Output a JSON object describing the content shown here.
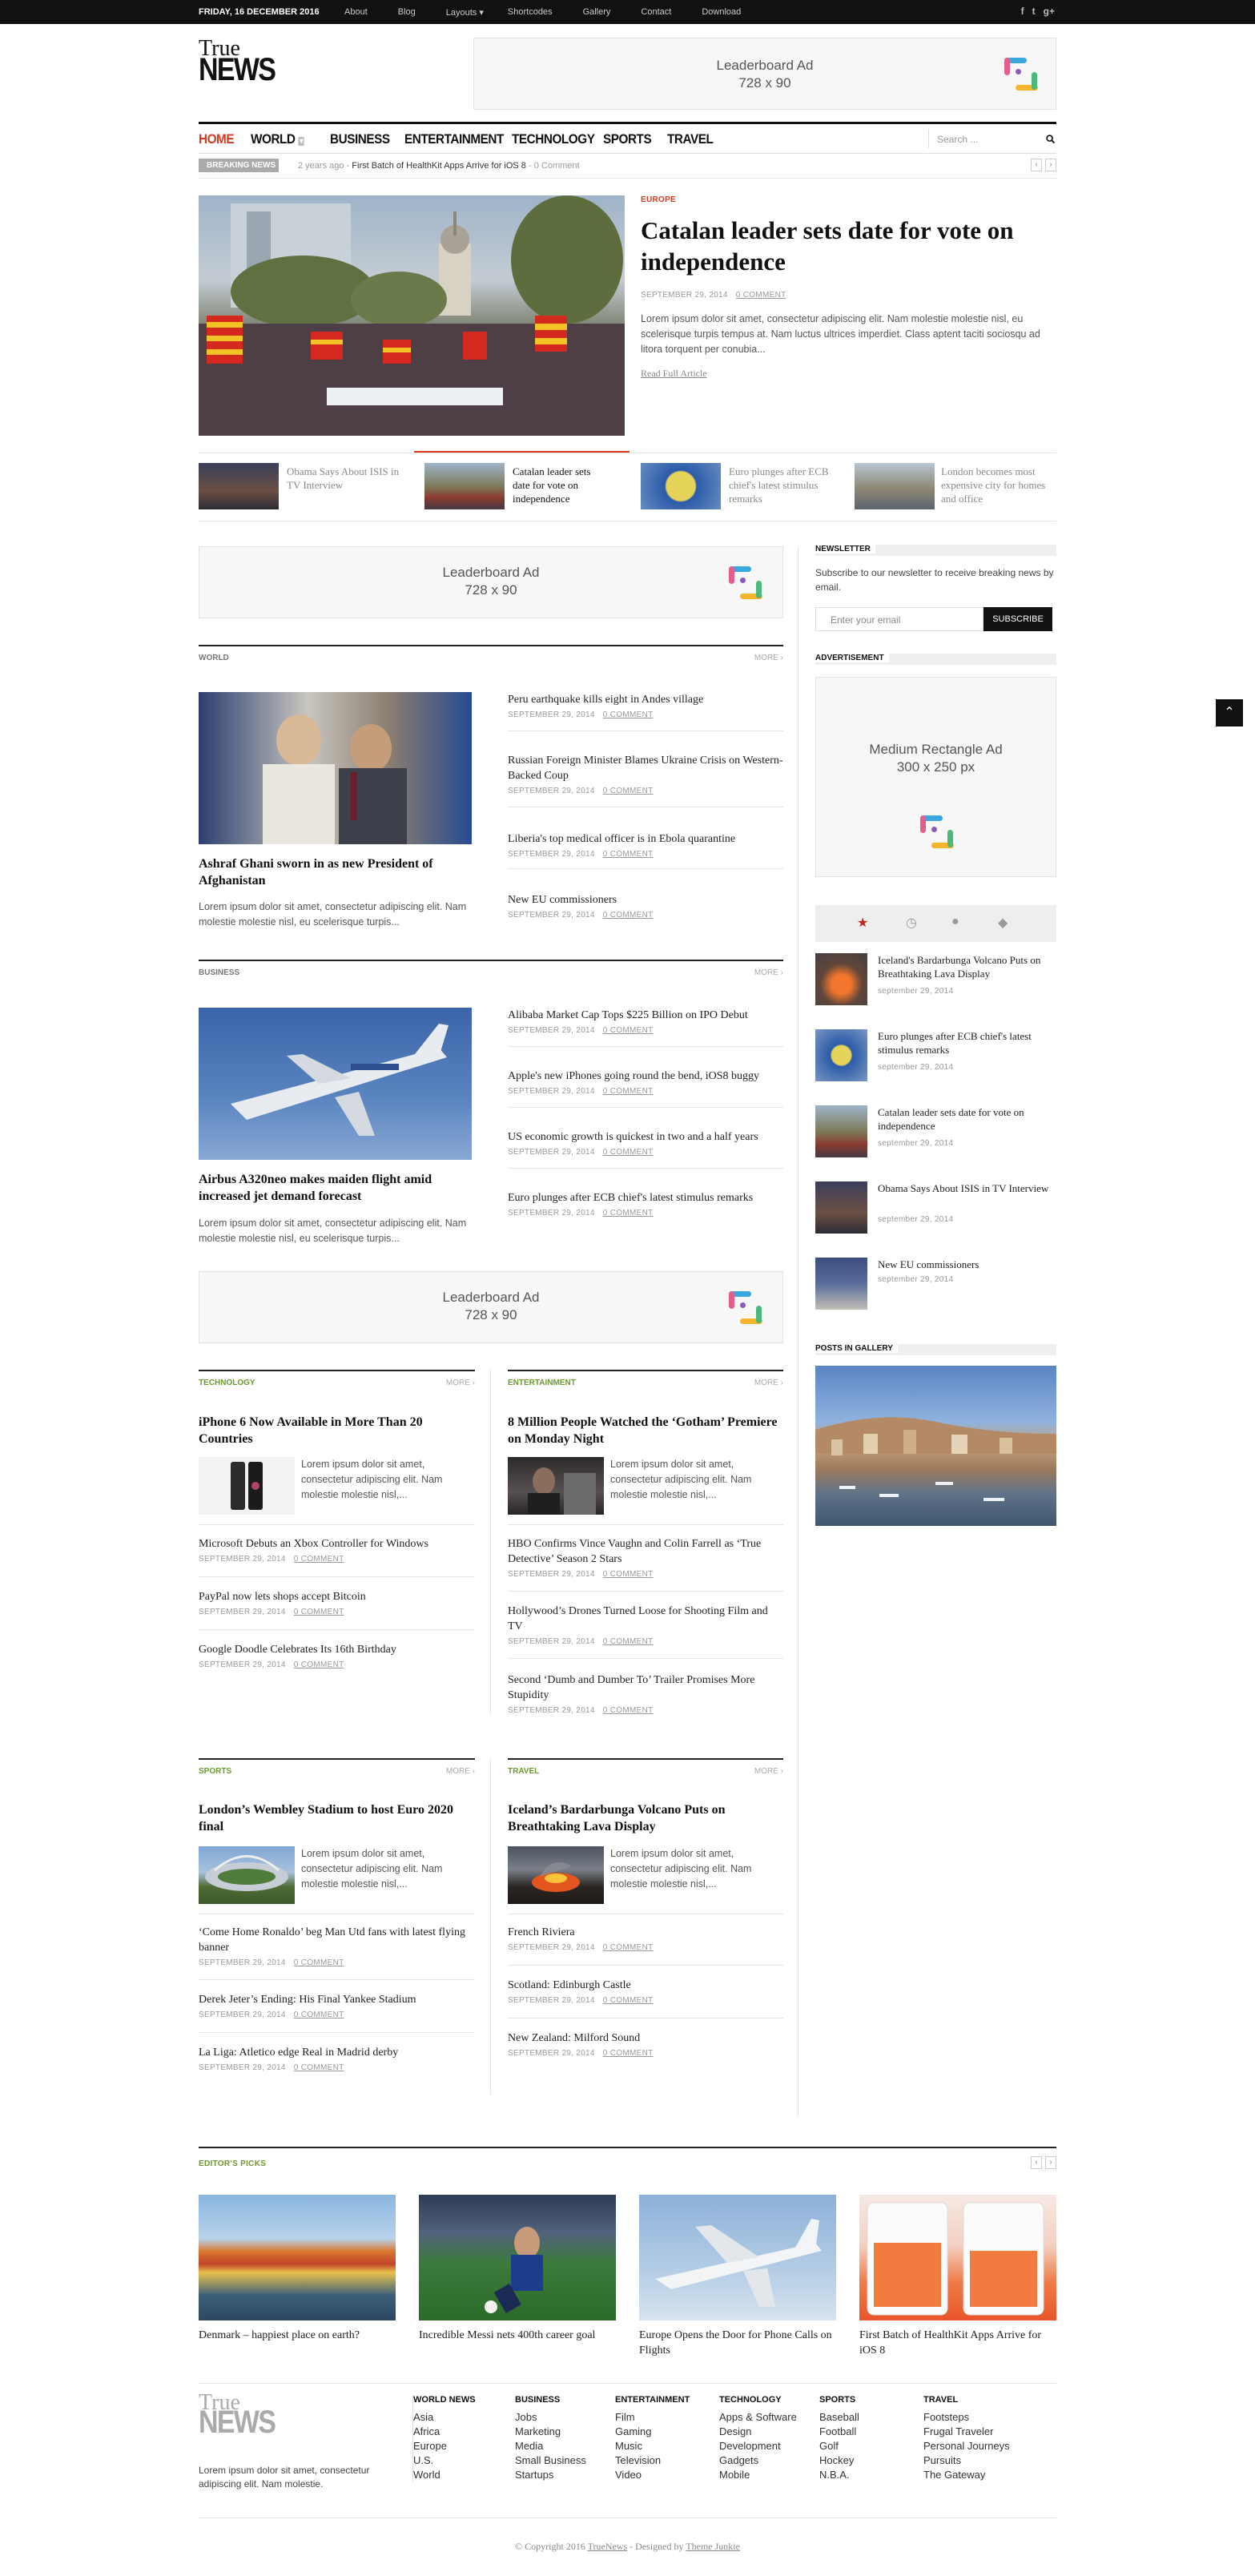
{
  "topbar": {
    "date": "FRIDAY, 16 DECEMBER 2016",
    "nav": [
      "About",
      "Blog",
      "Layouts",
      "Shortcodes",
      "Gallery",
      "Contact",
      "Download"
    ],
    "layouts_arrow": "▾",
    "social": [
      "f",
      "t",
      "g+"
    ]
  },
  "logo": {
    "line1": "True",
    "line2": "NEWS"
  },
  "ads": {
    "leaderboard_title": "Leaderboard Ad",
    "leaderboard_size": "728 x 90",
    "rect_title": "Medium Rectangle Ad",
    "rect_size": "300 x 250 px"
  },
  "nav": {
    "items": [
      "HOME",
      "WORLD",
      "BUSINESS",
      "ENTERTAINMENT",
      "TECHNOLOGY",
      "SPORTS",
      "TRAVEL"
    ],
    "world_arrow": "▾",
    "search_placeholder": "Search ..."
  },
  "breaking": {
    "label": "BREAKING NEWS",
    "time": "2 years ago",
    "sep": "-",
    "headline": "First Batch of HealthKit Apps Arrive for iOS 8",
    "comments": "- 0 Comment",
    "prev": "‹",
    "next": "›"
  },
  "hero": {
    "category": "EUROPE",
    "title": "Catalan leader sets date for vote on independence",
    "date": "SEPTEMBER 29, 2014",
    "comments": "0 COMMENT",
    "excerpt": "Lorem ipsum dolor sit amet, consectetur adipiscing elit. Nam molestie molestie nisl, eu scelerisque turpis tempus at. Nam luctus ultrices imperdiet. Class aptent taciti sociosqu ad litora torquent per conubia...",
    "read_more": "Read Full Article"
  },
  "strip": [
    {
      "title": "Obama Says About ISIS in TV Interview"
    },
    {
      "title": "Catalan leader sets date for vote on independence"
    },
    {
      "title": "Euro plunges after ECB chief's latest stimulus remarks"
    },
    {
      "title": "London becomes most expensive city for homes and office"
    }
  ],
  "world": {
    "label": "WORLD",
    "more": "MORE ›",
    "main_title": "Ashraf Ghani sworn in as new President of Afghanistan",
    "main_excerpt": "Lorem ipsum dolor sit amet, consectetur adipiscing elit. Nam molestie molestie nisl, eu scelerisque turpis...",
    "list": [
      {
        "title": "Peru earthquake kills eight in Andes village",
        "date": "SEPTEMBER 29, 2014",
        "comments": "0 COMMENT"
      },
      {
        "title": "Russian Foreign Minister Blames Ukraine Crisis on Western-Backed Coup",
        "date": "SEPTEMBER 29, 2014",
        "comments": "0 COMMENT"
      },
      {
        "title": "Liberia's top medical officer is in Ebola quarantine",
        "date": "SEPTEMBER 29, 2014",
        "comments": "0 COMMENT"
      },
      {
        "title": "New EU commissioners",
        "date": "SEPTEMBER 29, 2014",
        "comments": "0 COMMENT"
      }
    ]
  },
  "business": {
    "label": "BUSINESS",
    "more": "MORE ›",
    "main_title": "Airbus A320neo makes maiden flight amid increased jet demand forecast",
    "main_excerpt": "Lorem ipsum dolor sit amet, consectetur adipiscing elit. Nam molestie molestie nisl, eu scelerisque turpis...",
    "list": [
      {
        "title": "Alibaba Market Cap Tops $225 Billion on IPO Debut",
        "date": "SEPTEMBER 29, 2014",
        "comments": "0 COMMENT"
      },
      {
        "title": "Apple's new iPhones going round the bend, iOS8 buggy",
        "date": "SEPTEMBER 29, 2014",
        "comments": "0 COMMENT"
      },
      {
        "title": "US economic growth is quickest in two and a half years",
        "date": "SEPTEMBER 29, 2014",
        "comments": "0 COMMENT"
      },
      {
        "title": "Euro plunges after ECB chief's latest stimulus remarks",
        "date": "SEPTEMBER 29, 2014",
        "comments": "0 COMMENT"
      }
    ]
  },
  "technology": {
    "label": "TECHNOLOGY",
    "more": "MORE ›",
    "main_title": "iPhone 6 Now Available in More Than 20 Countries",
    "excerpt": "Lorem ipsum dolor sit amet, consectetur adipiscing elit. Nam molestie molestie nisl,...",
    "list": [
      {
        "title": "Microsoft Debuts an Xbox Controller for Windows",
        "date": "SEPTEMBER 29, 2014",
        "comments": "0 COMMENT"
      },
      {
        "title": "PayPal now lets shops accept Bitcoin",
        "date": "SEPTEMBER 29, 2014",
        "comments": "0 COMMENT"
      },
      {
        "title": "Google Doodle Celebrates Its 16th Birthday",
        "date": "SEPTEMBER 29, 2014",
        "comments": "0 COMMENT"
      }
    ]
  },
  "entertainment": {
    "label": "ENTERTAINMENT",
    "more": "MORE ›",
    "main_title": "8 Million People Watched the ‘Gotham’ Premiere on Monday Night",
    "excerpt": "Lorem ipsum dolor sit amet, consectetur adipiscing elit. Nam molestie molestie nisl,...",
    "list": [
      {
        "title": "HBO Confirms Vince Vaughn and Colin Farrell as ‘True Detective’ Season 2 Stars",
        "date": "SEPTEMBER 29, 2014",
        "comments": "0 COMMENT"
      },
      {
        "title": "Hollywood’s Drones Turned Loose for Shooting Film and TV",
        "date": "SEPTEMBER 29, 2014",
        "comments": "0 COMMENT"
      },
      {
        "title": "Second ‘Dumb and Dumber To’ Trailer Promises More Stupidity",
        "date": "SEPTEMBER 29, 2014",
        "comments": "0 COMMENT"
      }
    ]
  },
  "sports": {
    "label": "SPORTS",
    "more": "MORE ›",
    "main_title": "London’s Wembley Stadium to host Euro 2020 final",
    "excerpt": "Lorem ipsum dolor sit amet, consectetur adipiscing elit. Nam molestie molestie nisl,...",
    "list": [
      {
        "title": "‘Come Home Ronaldo’ beg Man Utd fans with latest flying banner",
        "date": "SEPTEMBER 29, 2014",
        "comments": "0 COMMENT"
      },
      {
        "title": "Derek Jeter’s Ending: His Final Yankee Stadium",
        "date": "SEPTEMBER 29, 2014",
        "comments": "0 COMMENT"
      },
      {
        "title": "La Liga: Atletico edge Real in Madrid derby",
        "date": "SEPTEMBER 29, 2014",
        "comments": "0 COMMENT"
      }
    ]
  },
  "travel": {
    "label": "TRAVEL",
    "more": "MORE ›",
    "main_title": "Iceland’s Bardarbunga Volcano Puts on Breathtaking Lava Display",
    "excerpt": "Lorem ipsum dolor sit amet, consectetur adipiscing elit. Nam molestie molestie nisl,...",
    "list": [
      {
        "title": "French Riviera",
        "date": "SEPTEMBER 29, 2014",
        "comments": "0 COMMENT"
      },
      {
        "title": "Scotland: Edinburgh Castle",
        "date": "SEPTEMBER 29, 2014",
        "comments": "0 COMMENT"
      },
      {
        "title": "New Zealand: Milford Sound",
        "date": "SEPTEMBER 29, 2014",
        "comments": "0 COMMENT"
      }
    ]
  },
  "sidebar": {
    "newsletter_title": "NEWSLETTER",
    "newsletter_text": "Subscribe to our newsletter to receive breaking news by email.",
    "email_placeholder": "Enter your email",
    "subscribe": "SUBSCRIBE",
    "ad_title": "ADVERTISEMENT",
    "tabs": [
      "★",
      "◷",
      "●",
      "◆"
    ],
    "posts": [
      {
        "title": "Iceland's Bardarbunga Volcano Puts on Breathtaking Lava Display",
        "date": "september 29, 2014"
      },
      {
        "title": "Euro plunges after ECB chief's latest stimulus remarks",
        "date": "september 29, 2014"
      },
      {
        "title": "Catalan leader sets date for vote on independence",
        "date": "september 29, 2014"
      },
      {
        "title": "Obama Says About ISIS in TV Interview",
        "date": "september 29, 2014"
      },
      {
        "title": "New EU commissioners",
        "date": "september 29, 2014"
      }
    ],
    "gallery_title": "POSTS IN GALLERY",
    "scroll_top": "⌃"
  },
  "editors": {
    "label": "EDITOR'S PICKS",
    "prev": "‹",
    "next": "›",
    "items": [
      {
        "title": "Denmark – happiest place on earth?"
      },
      {
        "title": "Incredible Messi nets 400th career goal"
      },
      {
        "title": "Europe Opens the Door for Phone Calls on Flights"
      },
      {
        "title": "First Batch of HealthKit Apps Arrive for iOS 8"
      }
    ]
  },
  "footer": {
    "logo1": "True",
    "logo2": "NEWS",
    "about": "Lorem ipsum dolor sit amet, consectetur adipiscing elit. Nam molestie.",
    "cols": [
      {
        "title": "WORLD NEWS",
        "links": [
          "Asia",
          "Africa",
          "Europe",
          "U.S.",
          "World"
        ]
      },
      {
        "title": "BUSINESS",
        "links": [
          "Jobs",
          "Marketing",
          "Media",
          "Small Business",
          "Startups"
        ]
      },
      {
        "title": "ENTERTAINMENT",
        "links": [
          "Film",
          "Gaming",
          "Music",
          "Television",
          "Video"
        ]
      },
      {
        "title": "TECHNOLOGY",
        "links": [
          "Apps & Software",
          "Design",
          "Development",
          "Gadgets",
          "Mobile"
        ]
      },
      {
        "title": "SPORTS",
        "links": [
          "Baseball",
          "Football",
          "Golf",
          "Hockey",
          "N.B.A."
        ]
      },
      {
        "title": "TRAVEL",
        "links": [
          "Footsteps",
          "Frugal Traveler",
          "Personal Journeys",
          "Pursuits",
          "The Gateway"
        ]
      }
    ],
    "copyright_prefix": "© Copyright 2016",
    "brand": "TrueNews",
    "designed_prefix": "- Designed by",
    "designer": "Theme Junkie"
  },
  "colors": {
    "accent": "#d9381e",
    "dark": "#111111",
    "link_grey": "#999999",
    "green": "#6a9a2c"
  }
}
